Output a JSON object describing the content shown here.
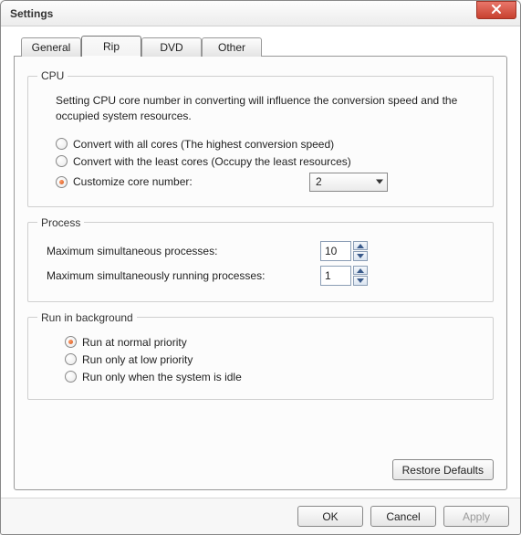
{
  "window": {
    "title": "Settings"
  },
  "tabs": {
    "items": [
      {
        "label": "General"
      },
      {
        "label": "Rip"
      },
      {
        "label": "DVD"
      },
      {
        "label": "Other"
      }
    ],
    "active_index": 1
  },
  "cpu": {
    "legend": "CPU",
    "description": "Setting CPU core number in converting will influence the conversion speed and the occupied system resources.",
    "opt_all": "Convert with all cores (The highest conversion speed)",
    "opt_least": "Convert with the least cores (Occupy the least resources)",
    "opt_custom": "Customize core number:",
    "selected": "custom",
    "core_value": "2"
  },
  "process": {
    "legend": "Process",
    "max_sim_label": "Maximum simultaneous processes:",
    "max_sim_value": "10",
    "max_run_label": "Maximum simultaneously running processes:",
    "max_run_value": "1"
  },
  "background": {
    "legend": "Run in background",
    "opt_normal": "Run at normal priority",
    "opt_low": "Run only at low priority",
    "opt_idle": "Run only when the system is idle",
    "selected": "normal"
  },
  "buttons": {
    "restore": "Restore Defaults",
    "ok": "OK",
    "cancel": "Cancel",
    "apply": "Apply"
  }
}
